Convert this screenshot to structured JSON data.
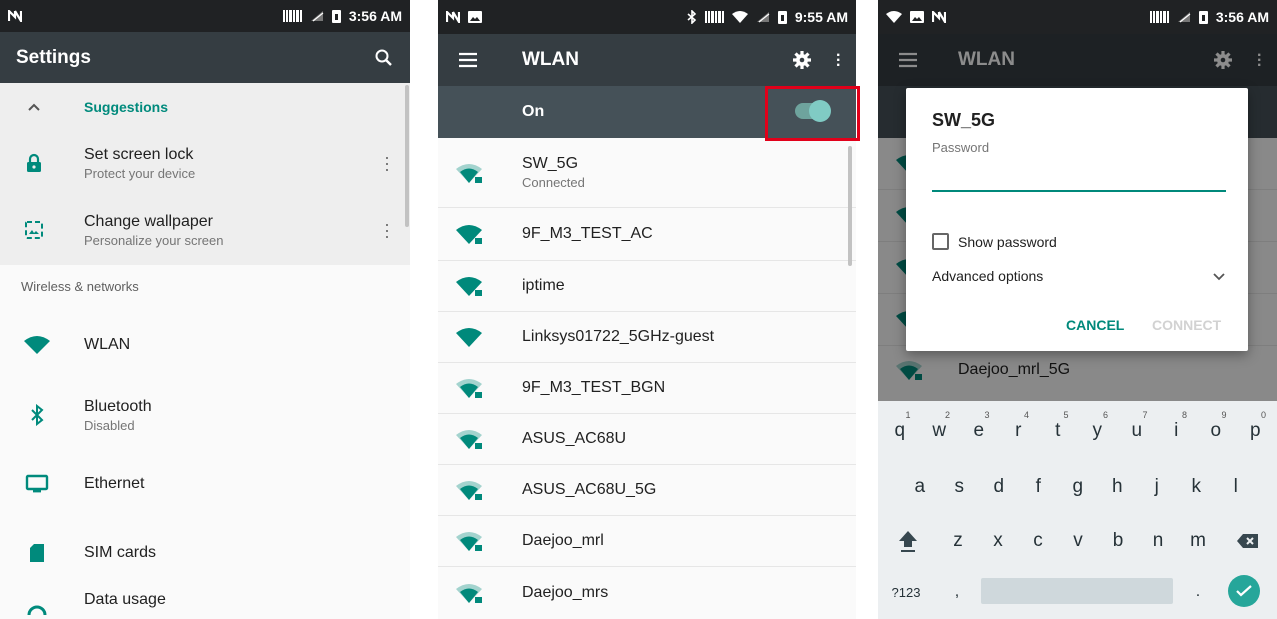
{
  "screen1": {
    "status": {
      "time": "3:56 AM"
    },
    "appbar": {
      "title": "Settings"
    },
    "suggestions": {
      "header": "Suggestions",
      "items": [
        {
          "title": "Set screen lock",
          "subtitle": "Protect your device",
          "icon": "lock-icon"
        },
        {
          "title": "Change wallpaper",
          "subtitle": "Personalize your screen",
          "icon": "wallpaper-icon"
        }
      ]
    },
    "section_label": "Wireless & networks",
    "items": [
      {
        "title": "WLAN",
        "subtitle": "",
        "icon": "wifi-icon"
      },
      {
        "title": "Bluetooth",
        "subtitle": "Disabled",
        "icon": "bluetooth-icon"
      },
      {
        "title": "Ethernet",
        "subtitle": "",
        "icon": "ethernet-icon"
      },
      {
        "title": "SIM cards",
        "subtitle": "",
        "icon": "sim-card-icon"
      },
      {
        "title": "Data usage",
        "subtitle": "",
        "icon": "data-usage-icon"
      }
    ]
  },
  "screen2": {
    "status": {
      "time": "9:55 AM"
    },
    "appbar": {
      "title": "WLAN"
    },
    "toggle": {
      "label": "On",
      "state": "on"
    },
    "networks": [
      {
        "name": "SW_5G",
        "status": "Connected",
        "locked": true
      },
      {
        "name": "9F_M3_TEST_AC",
        "status": "",
        "locked": true
      },
      {
        "name": "iptime",
        "status": "",
        "locked": true
      },
      {
        "name": "Linksys01722_5GHz-guest",
        "status": "",
        "locked": false
      },
      {
        "name": "9F_M3_TEST_BGN",
        "status": "",
        "locked": true
      },
      {
        "name": "ASUS_AC68U",
        "status": "",
        "locked": true
      },
      {
        "name": "ASUS_AC68U_5G",
        "status": "",
        "locked": true
      },
      {
        "name": "Daejoo_mrl",
        "status": "",
        "locked": true
      },
      {
        "name": "Daejoo_mrs",
        "status": "",
        "locked": true
      }
    ]
  },
  "screen3": {
    "status": {
      "time": "3:56 AM"
    },
    "appbar": {
      "title": "WLAN"
    },
    "background_network": "Daejoo_mrl_5G",
    "dialog": {
      "title": "SW_5G",
      "password_label": "Password",
      "password_value": "",
      "show_password": "Show password",
      "advanced": "Advanced options",
      "cancel": "CANCEL",
      "connect": "CONNECT"
    },
    "keyboard": {
      "row1": [
        "q",
        "w",
        "e",
        "r",
        "t",
        "y",
        "u",
        "i",
        "o",
        "p"
      ],
      "row1_hints": [
        "1",
        "2",
        "3",
        "4",
        "5",
        "6",
        "7",
        "8",
        "9",
        "0"
      ],
      "row2": [
        "a",
        "s",
        "d",
        "f",
        "g",
        "h",
        "j",
        "k",
        "l"
      ],
      "row3": [
        "z",
        "x",
        "c",
        "v",
        "b",
        "n",
        "m"
      ],
      "symbols": "?123",
      "comma": ",",
      "period": "."
    }
  },
  "colors": {
    "accent": "#00897b",
    "appbar": "#353d42",
    "highlight": "#e1001a"
  }
}
